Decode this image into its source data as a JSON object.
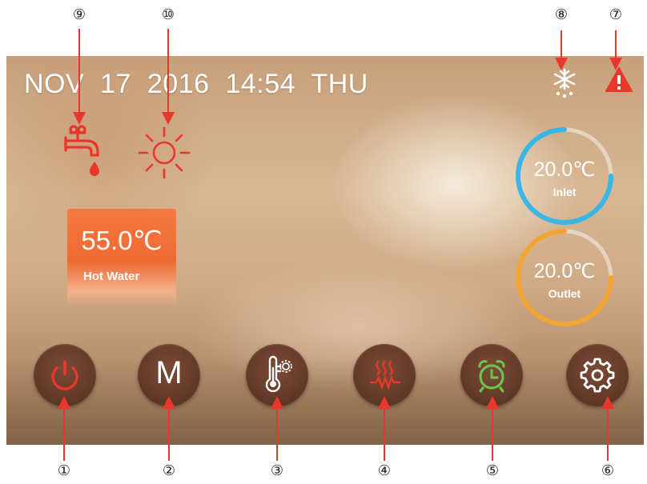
{
  "status_bar": {
    "date": "NOV 17 2016",
    "time": "14:54",
    "weekday": "THU"
  },
  "hot_water": {
    "temperature": "55.0℃",
    "label": "Hot Water"
  },
  "inlet": {
    "temperature": "20.0℃",
    "label": "Inlet",
    "ring_color": "#39b6e6"
  },
  "outlet": {
    "temperature": "20.0℃",
    "label": "Outlet",
    "ring_color": "#f3a534"
  },
  "icons": {
    "faucet": "hot-water-tap-icon",
    "sun": "sun-icon",
    "defrost": "defrost-icon",
    "alarm": "warning-icon"
  },
  "buttons": {
    "power": {
      "icon": "power-icon",
      "color": "#e8372b"
    },
    "mode": {
      "label": "M"
    },
    "thermometer": {
      "icon": "thermometer-gear-icon"
    },
    "heater": {
      "icon": "electric-heater-icon",
      "color": "#e8372b"
    },
    "timer": {
      "icon": "alarm-clock-icon",
      "color": "#6cc24a"
    },
    "settings": {
      "icon": "gear-icon"
    }
  },
  "callouts": {
    "c1": "①",
    "c2": "②",
    "c3": "③",
    "c4": "④",
    "c5": "⑤",
    "c6": "⑥",
    "c7": "⑦",
    "c8": "⑧",
    "c9": "⑨",
    "c10": "⑩"
  },
  "colors": {
    "accent_red": "#e8372b",
    "hot_water_card": "#f07238"
  }
}
